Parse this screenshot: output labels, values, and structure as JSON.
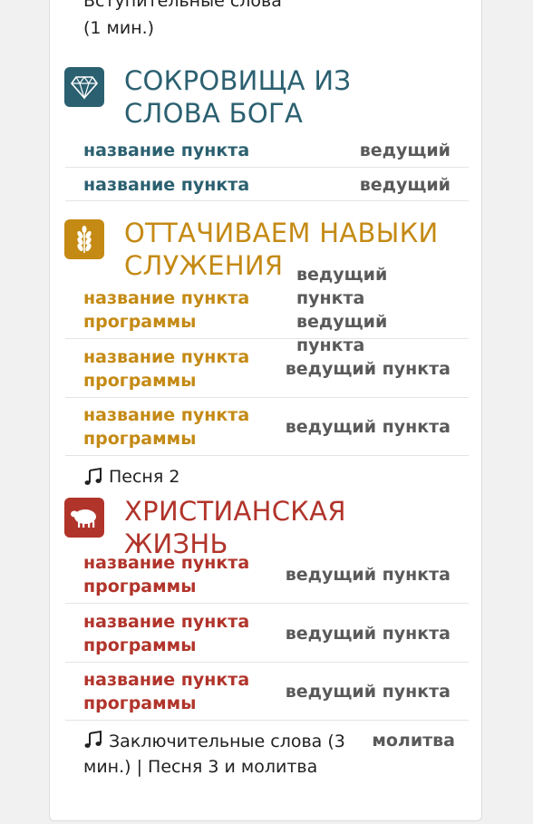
{
  "intro": {
    "line1": "Вступительные слова",
    "line2": "(1 мин.)"
  },
  "sections": [
    {
      "title": "СОКРОВИЩА ИЗ СЛОВА БОГА",
      "icon": "diamond-icon",
      "color": "#2b6070",
      "rows": [
        {
          "item": "название пункта",
          "host": "ведущий"
        },
        {
          "item": "название пункта",
          "host": "ведущий"
        }
      ]
    },
    {
      "title": "ОТТАЧИВАЕМ НАВЫКИ СЛУЖЕНИЯ",
      "icon": "wheat-icon",
      "color": "#c48a14",
      "rows": [
        {
          "item": "название пункта программы",
          "host": "ведущий пункта ведущий пункта"
        },
        {
          "item": "название пункта программы",
          "host": "ведущий пункта"
        },
        {
          "item": "название пункта программы",
          "host": "ведущий пункта"
        }
      ]
    },
    {
      "title": "ХРИСТИАНСКАЯ ЖИЗНЬ",
      "icon": "sheep-icon",
      "color": "#b1342b",
      "rows": [
        {
          "item": "название пункта программы",
          "host": "ведущий пункта"
        },
        {
          "item": "название пункта программы",
          "host": "ведущий пункта"
        },
        {
          "item": "название пункта программы",
          "host": "ведущий пункта"
        }
      ]
    }
  ],
  "song_middle": "Песня 2",
  "closing": {
    "text": "Заключительные слова (3 мин.) | Песня 3 и молитва",
    "host": "молитва"
  }
}
